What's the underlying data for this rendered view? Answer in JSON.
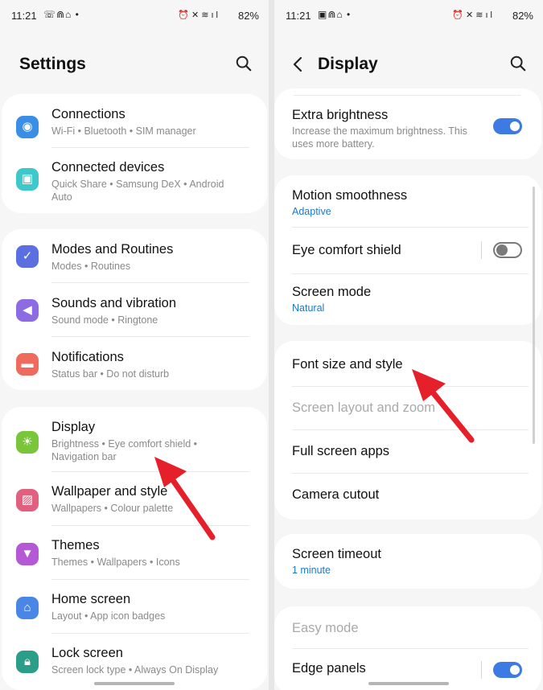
{
  "left": {
    "status": {
      "time": "11:21",
      "battery": "82%"
    },
    "title": "Settings",
    "items": [
      {
        "label": "Connections",
        "sub": "Wi-Fi  •  Bluetooth  •  SIM manager",
        "icon": "wifi-icon",
        "color": "#3b8ee6"
      },
      {
        "label": "Connected devices",
        "sub": "Quick Share  •  Samsung DeX  •  Android Auto",
        "icon": "devices-icon",
        "color": "#3ec8c9"
      },
      {
        "label": "Modes and Routines",
        "sub": "Modes  •  Routines",
        "icon": "check-circle-icon",
        "color": "#5a6fe0"
      },
      {
        "label": "Sounds and vibration",
        "sub": "Sound mode  •  Ringtone",
        "icon": "speaker-icon",
        "color": "#8d6be3"
      },
      {
        "label": "Notifications",
        "sub": "Status bar  •  Do not disturb",
        "icon": "bell-icon",
        "color": "#ee6b5e"
      },
      {
        "label": "Display",
        "sub": "Brightness  •  Eye comfort shield  •  Navigation bar",
        "icon": "sun-icon",
        "color": "#7ac63b"
      },
      {
        "label": "Wallpaper and style",
        "sub": "Wallpapers  •  Colour palette",
        "icon": "image-icon",
        "color": "#e2607f"
      },
      {
        "label": "Themes",
        "sub": "Themes  •  Wallpapers  •  Icons",
        "icon": "theme-icon",
        "color": "#b558d6"
      },
      {
        "label": "Home screen",
        "sub": "Layout  •  App icon badges",
        "icon": "home-icon",
        "color": "#4a86e5"
      },
      {
        "label": "Lock screen",
        "sub": "Screen lock type  •  Always On Display",
        "icon": "lock-icon",
        "color": "#2b9e8a"
      }
    ]
  },
  "right": {
    "status": {
      "time": "11:21",
      "battery": "82%"
    },
    "title": "Display",
    "extra_brightness": {
      "label": "Extra brightness",
      "sub": "Increase the maximum brightness. This uses more battery.",
      "on": true
    },
    "motion_smoothness": {
      "label": "Motion smoothness",
      "value": "Adaptive"
    },
    "eye_comfort": {
      "label": "Eye comfort shield",
      "on": false
    },
    "screen_mode": {
      "label": "Screen mode",
      "value": "Natural"
    },
    "font_size": {
      "label": "Font size and style"
    },
    "screen_layout": {
      "label": "Screen layout and zoom"
    },
    "full_screen": {
      "label": "Full screen apps"
    },
    "camera_cutout": {
      "label": "Camera cutout"
    },
    "screen_timeout": {
      "label": "Screen timeout",
      "value": "1 minute"
    },
    "easy_mode": {
      "label": "Easy mode"
    },
    "edge_panels": {
      "label": "Edge panels",
      "on": true
    }
  },
  "accent": "#3e7ae3",
  "annotation_color": "#e6202a"
}
